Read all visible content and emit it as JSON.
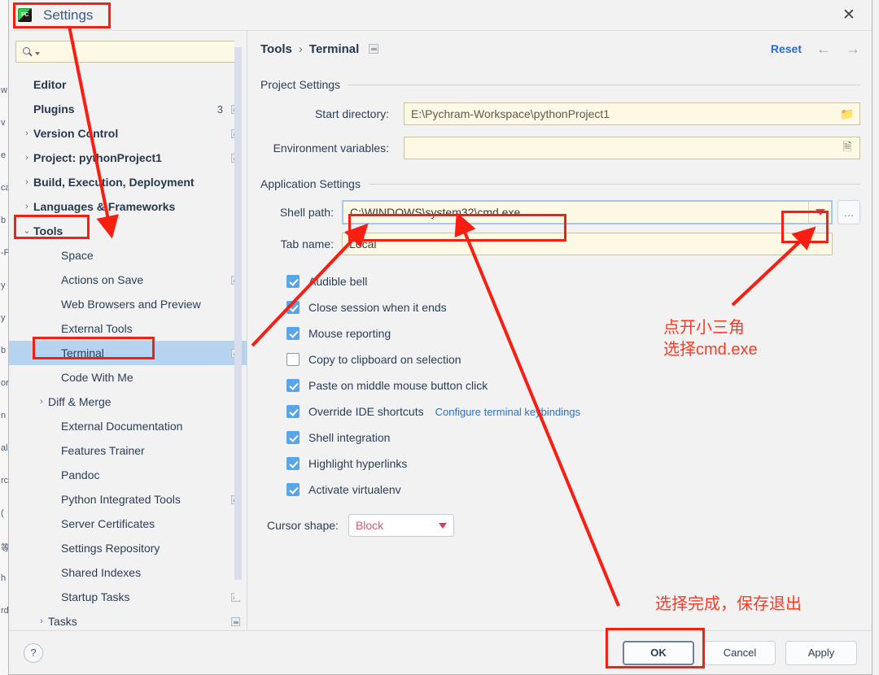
{
  "background_window": {
    "fragments": [
      "w",
      "v",
      "e",
      "ca",
      "b",
      "-P",
      "y",
      "y",
      "b",
      "or",
      "n",
      "al",
      "rc",
      "(",
      "等",
      "h",
      "rd"
    ]
  },
  "dialog": {
    "title": "Settings",
    "app_icon": "pycharm-icon",
    "close_icon": "✕"
  },
  "sidebar": {
    "search": {
      "value": "",
      "placeholder": "",
      "icon": "search-icon"
    },
    "items": [
      {
        "label": "Editor",
        "level": 0,
        "arrow": "",
        "badge": "",
        "mark": false,
        "selected": false
      },
      {
        "label": "Plugins",
        "level": 0,
        "arrow": "",
        "badge": "3",
        "mark": true,
        "selected": false
      },
      {
        "label": "Version Control",
        "level": 0,
        "arrow": "›",
        "badge": "",
        "mark": true,
        "selected": false
      },
      {
        "label": "Project: pythonProject1",
        "level": 0,
        "arrow": "›",
        "badge": "",
        "mark": true,
        "selected": false
      },
      {
        "label": "Build, Execution, Deployment",
        "level": 0,
        "arrow": "›",
        "badge": "",
        "mark": false,
        "selected": false
      },
      {
        "label": "Languages & Frameworks",
        "level": 0,
        "arrow": "›",
        "badge": "",
        "mark": false,
        "selected": false
      },
      {
        "label": "Tools",
        "level": 0,
        "arrow": "⌄",
        "badge": "",
        "mark": false,
        "selected": false
      },
      {
        "label": "Space",
        "level": 1,
        "arrow": "",
        "badge": "",
        "mark": false,
        "selected": false
      },
      {
        "label": "Actions on Save",
        "level": 1,
        "arrow": "",
        "badge": "",
        "mark": true,
        "selected": false
      },
      {
        "label": "Web Browsers and Preview",
        "level": 1,
        "arrow": "",
        "badge": "",
        "mark": false,
        "selected": false
      },
      {
        "label": "External Tools",
        "level": 1,
        "arrow": "",
        "badge": "",
        "mark": false,
        "selected": false
      },
      {
        "label": "Terminal",
        "level": 1,
        "arrow": "",
        "badge": "",
        "mark": true,
        "selected": true
      },
      {
        "label": "Code With Me",
        "level": 1,
        "arrow": "",
        "badge": "",
        "mark": false,
        "selected": false
      },
      {
        "label": "Diff & Merge",
        "level": 1,
        "arrow": "›",
        "badge": "",
        "mark": false,
        "selected": false
      },
      {
        "label": "External Documentation",
        "level": 1,
        "arrow": "",
        "badge": "",
        "mark": false,
        "selected": false
      },
      {
        "label": "Features Trainer",
        "level": 1,
        "arrow": "",
        "badge": "",
        "mark": false,
        "selected": false
      },
      {
        "label": "Pandoc",
        "level": 1,
        "arrow": "",
        "badge": "",
        "mark": false,
        "selected": false
      },
      {
        "label": "Python Integrated Tools",
        "level": 1,
        "arrow": "",
        "badge": "",
        "mark": true,
        "selected": false
      },
      {
        "label": "Server Certificates",
        "level": 1,
        "arrow": "",
        "badge": "",
        "mark": false,
        "selected": false
      },
      {
        "label": "Settings Repository",
        "level": 1,
        "arrow": "",
        "badge": "",
        "mark": false,
        "selected": false
      },
      {
        "label": "Shared Indexes",
        "level": 1,
        "arrow": "",
        "badge": "",
        "mark": false,
        "selected": false
      },
      {
        "label": "Startup Tasks",
        "level": 1,
        "arrow": "",
        "badge": "",
        "mark": true,
        "selected": false
      },
      {
        "label": "Tasks",
        "level": 1,
        "arrow": "›",
        "badge": "",
        "mark": true,
        "selected": false
      }
    ]
  },
  "main": {
    "breadcrumb": {
      "parent": "Tools",
      "separator": "›",
      "current": "Terminal"
    },
    "reset_label": "Reset",
    "back_arrow": "←",
    "forward_arrow": "→",
    "project_settings": {
      "title": "Project Settings",
      "start_directory_label": "Start directory:",
      "start_directory_value": "E:\\Pychram-Workspace\\pythonProject1",
      "start_directory_icon": "folder-icon",
      "environment_variables_label": "Environment variables:",
      "environment_variables_value": "",
      "environment_variables_icon": "list-edit-icon"
    },
    "application_settings": {
      "title": "Application Settings",
      "shell_path_label": "Shell path:",
      "shell_path_value": "C:\\WINDOWS\\system32\\cmd.exe",
      "shell_path_dropdown_icon": "chevron-down-icon",
      "shell_path_browse_label": "…",
      "tab_name_label": "Tab name:",
      "tab_name_value": "Local",
      "checkboxes": [
        {
          "label": "Audible bell",
          "checked": true
        },
        {
          "label": "Close session when it ends",
          "checked": true
        },
        {
          "label": "Mouse reporting",
          "checked": true
        },
        {
          "label": "Copy to clipboard on selection",
          "checked": false
        },
        {
          "label": "Paste on middle mouse button click",
          "checked": true
        },
        {
          "label": "Override IDE shortcuts",
          "checked": true,
          "link": "Configure terminal keybindings"
        },
        {
          "label": "Shell integration",
          "checked": true
        },
        {
          "label": "Highlight hyperlinks",
          "checked": true
        },
        {
          "label": "Activate virtualenv",
          "checked": true
        }
      ],
      "cursor_shape_label": "Cursor shape:",
      "cursor_shape_value": "Block"
    }
  },
  "footer": {
    "help_label": "?",
    "ok_label": "OK",
    "cancel_label": "Cancel",
    "apply_label": "Apply"
  },
  "annotations": {
    "note_dropdown": "点开小三角\n选择cmd.exe",
    "note_save": "选择完成，保存退出",
    "highlight_color": "#f81f12",
    "text_color": "#fb3a24"
  }
}
